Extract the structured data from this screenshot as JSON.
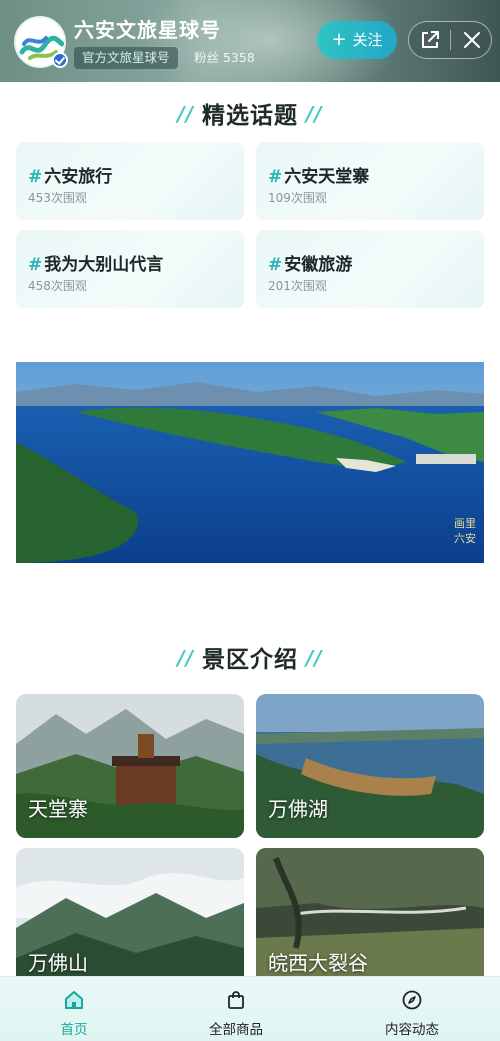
{
  "header": {
    "account_name": "六安文旅星球号",
    "official_tag": "官方文旅星球号",
    "fans": "粉丝 5358",
    "follow_label": "关注",
    "follow_plus": "+",
    "icons": [
      "share-icon",
      "close-icon"
    ]
  },
  "topics": {
    "title": "精选话题",
    "items": [
      {
        "name": "六安旅行",
        "views": "453次围观"
      },
      {
        "name": "六安天堂寨",
        "views": "109次围观"
      },
      {
        "name": "我为大别山代言",
        "views": "458次围观"
      },
      {
        "name": "安徽旅游",
        "views": "201次围观"
      }
    ]
  },
  "banner": {
    "watermark": "画里六安"
  },
  "scenic": {
    "title": "景区介绍",
    "items": [
      {
        "name": "天堂寨"
      },
      {
        "name": "万佛湖"
      },
      {
        "name": "万佛山"
      },
      {
        "name": "皖西大裂谷"
      }
    ]
  },
  "bottom_nav": {
    "items": [
      {
        "label": "首页",
        "icon": "home-icon",
        "active": true
      },
      {
        "label": "全部商品",
        "icon": "shopping-bag-icon",
        "active": false
      },
      {
        "label": "内容动态",
        "icon": "compass-icon",
        "active": false
      }
    ]
  },
  "colors": {
    "accent": "#1aa6a0",
    "follow_gradient_start": "#2fc4c1",
    "follow_gradient_end": "#22a7c6",
    "topic_card_bg": "#eaf7f6",
    "nav_bg": "#e9f8f6"
  }
}
